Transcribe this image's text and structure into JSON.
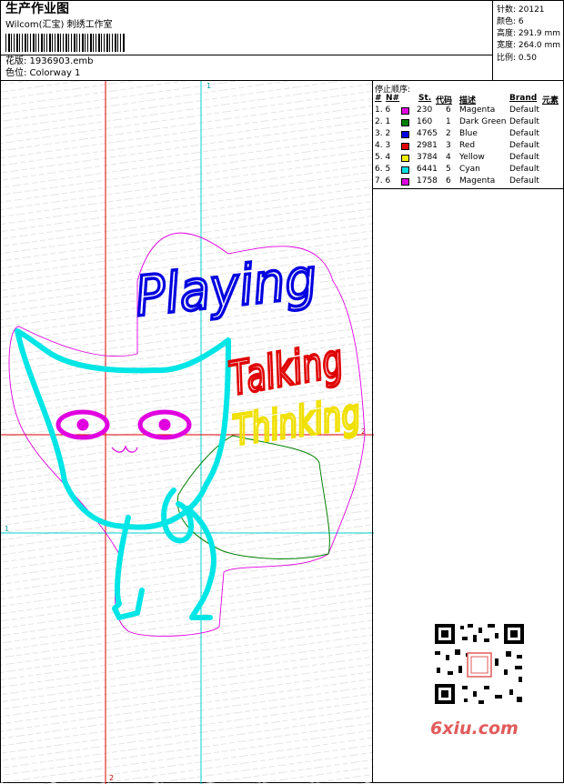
{
  "header": {
    "title": "生产作业图",
    "company": "Wilcom(汇宝) 刺绣工作室",
    "file_label": "花版: 1936903.emb",
    "colorway_label": "色位: Colorway 1"
  },
  "stats": {
    "stitches": "针数: 20121",
    "colors": "颜色: 6",
    "height": "高度: 291.9 mm",
    "width": "宽度: 264.0 mm",
    "scale": "比例: 0.50"
  },
  "stop_sequence": {
    "title": "停止顺序:",
    "headers": [
      "#",
      "N#",
      "St.",
      "代码",
      "描述",
      "Brand",
      "元素"
    ],
    "rows": [
      {
        "index": "1. 6",
        "color": "#e000e0",
        "stitches": "230",
        "code": "6",
        "desc": "Magenta",
        "brand": "Default"
      },
      {
        "index": "2. 1",
        "color": "#008000",
        "stitches": "160",
        "code": "1",
        "desc": "Dark Green",
        "brand": "Default"
      },
      {
        "index": "3. 2",
        "color": "#0000e0",
        "stitches": "4765",
        "code": "2",
        "desc": "Blue",
        "brand": "Default"
      },
      {
        "index": "4. 3",
        "color": "#e00000",
        "stitches": "2981",
        "code": "3",
        "desc": "Red",
        "brand": "Default"
      },
      {
        "index": "5. 4",
        "color": "#f0f000",
        "stitches": "3784",
        "code": "4",
        "desc": "Yellow",
        "brand": "Default"
      },
      {
        "index": "6. 5",
        "color": "#00e0e0",
        "stitches": "6441",
        "code": "5",
        "desc": "Cyan",
        "brand": "Default"
      },
      {
        "index": "7. 6",
        "color": "#e000e0",
        "stitches": "1758",
        "code": "6",
        "desc": "Magenta",
        "brand": "Default"
      }
    ]
  },
  "canvas": {
    "marker_1": "1",
    "marker_2": "2",
    "text_playing": "Playing",
    "text_talking": "Talking",
    "text_thinking": "Thinking"
  },
  "watermark": {
    "site": "6xiu.com"
  }
}
